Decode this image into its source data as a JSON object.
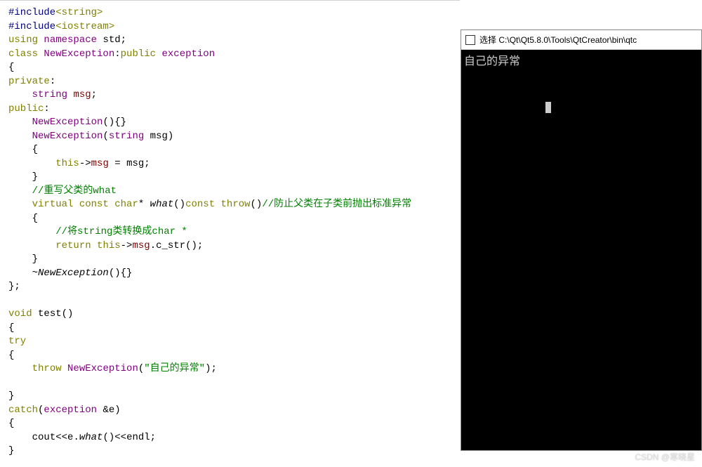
{
  "code": {
    "l1": {
      "a": "#include",
      "b": "<string>"
    },
    "l2": {
      "a": "#include",
      "b": "<iostream>"
    },
    "l3": {
      "a": "using",
      "b": "namespace",
      "c": "std",
      ";": ";"
    },
    "l4": {
      "a": "class",
      "b": "NewException",
      "c": ":",
      "d": "public",
      "e": "exception"
    },
    "l5": "{",
    "l6": {
      "a": "private",
      "b": ":"
    },
    "l7": {
      "a": "string",
      "b": "msg",
      "c": ";"
    },
    "l8": {
      "a": "public",
      "b": ":"
    },
    "l9": {
      "a": "NewException",
      "b": "(){}"
    },
    "l10": {
      "a": "NewException",
      "b": "(",
      "c": "string",
      "d": "msg",
      "e": ")"
    },
    "l11": "    {",
    "l12": {
      "a": "this",
      "b": "->",
      "c": "msg",
      "d": " = ",
      "e": "msg",
      "f": ";"
    },
    "l13": "    }",
    "l14": "    //重写父类的what",
    "l15": {
      "a": "virtual",
      "b": "const",
      "c": "char",
      "d": "*",
      "e": "what",
      "f": "()",
      "g": "const",
      "h": "throw",
      "i": "()",
      "j": "//防止父类在子类前抛出标准异常"
    },
    "l16": "    {",
    "l17": "        //将string类转换成char *",
    "l18": {
      "a": "return",
      "b": "this",
      "c": "->",
      "d": "msg",
      "e": ".",
      "f": "c_str",
      "g": "();"
    },
    "l19": "    }",
    "l20": {
      "a": "~",
      "b": "NewException",
      "c": "(){}"
    },
    "l21": "};",
    "l22": " ",
    "l23": {
      "a": "void",
      "b": "test",
      "c": "()"
    },
    "l24": "{",
    "l25": "try",
    "l26": "{",
    "l27": {
      "a": "throw",
      "b": "NewException",
      "c": "(",
      "d": "\"自己的异常\"",
      "e": ");"
    },
    "l28": " ",
    "l29": "}",
    "l30": {
      "a": "catch",
      "b": "(",
      "c": "exception",
      "d": "&",
      "e": "e",
      "f": ")"
    },
    "l31": "{",
    "l32": {
      "a": "cout",
      "b": "<<",
      "c": "e",
      "d": ".",
      "e": "what",
      "f": "()<<",
      "g": "endl",
      "h": ";"
    },
    "l33": "}"
  },
  "console": {
    "title_prefix": "选择",
    "title_path": "C:\\Qt\\Qt5.8.0\\Tools\\QtCreator\\bin\\qtc",
    "output": "自己的异常"
  },
  "watermark": "CSDN @寒晓星"
}
